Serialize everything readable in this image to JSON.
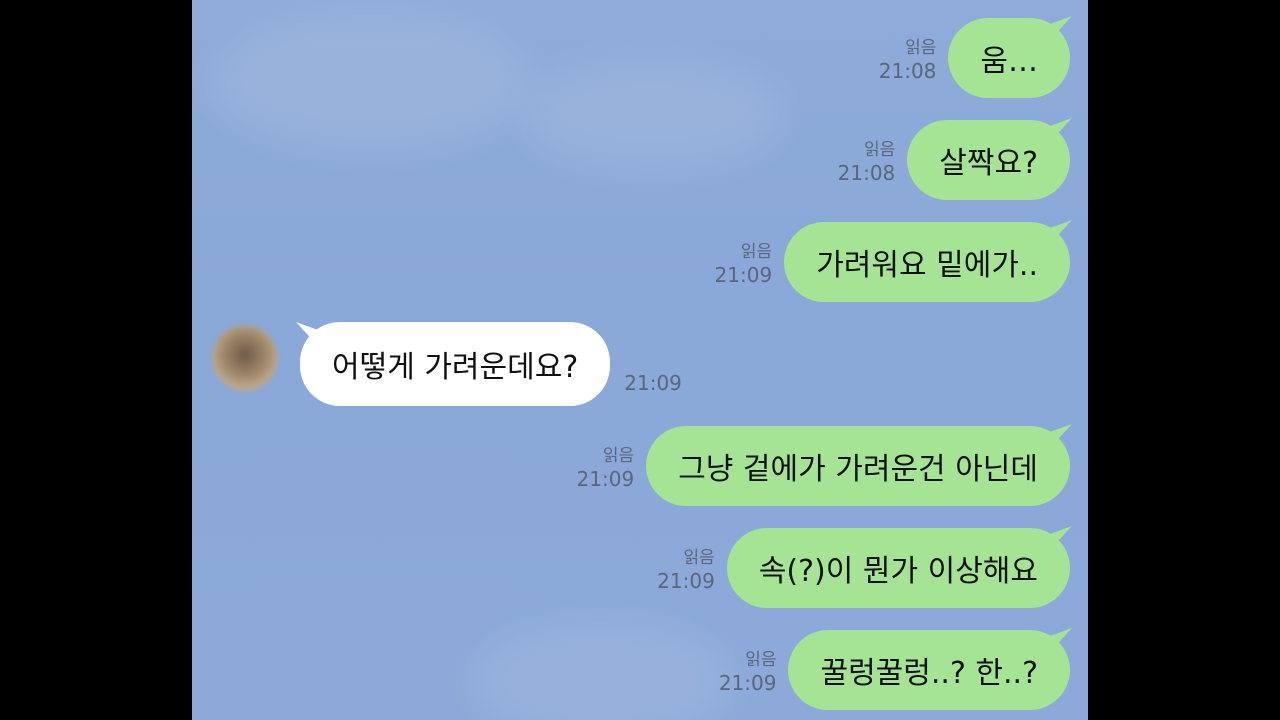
{
  "chat": {
    "outgoing_top": [
      {
        "text": "움…",
        "read": "읽음",
        "time": "21:08"
      },
      {
        "text": "살짝요?",
        "read": "읽음",
        "time": "21:08"
      },
      {
        "text": "가려워요 밑에가..",
        "read": "읽음",
        "time": "21:09"
      }
    ],
    "incoming": {
      "text": "어떻게 가려운데요?",
      "time": "21:09"
    },
    "outgoing_bottom": [
      {
        "text": "그냥 겉에가 가려운건 아닌데",
        "read": "읽음",
        "time": "21:09"
      },
      {
        "text": "속(?)이 뭔가 이상해요",
        "read": "읽음",
        "time": "21:09"
      },
      {
        "text": "꿀렁꿀렁..? 한..?",
        "read": "읽음",
        "time": "21:09"
      }
    ]
  },
  "colors": {
    "background": "#8aa8d8",
    "outgoing_bubble": "#a5e494",
    "incoming_bubble": "#ffffff",
    "meta_text": "#5b667a",
    "letterbox": "#000000"
  }
}
